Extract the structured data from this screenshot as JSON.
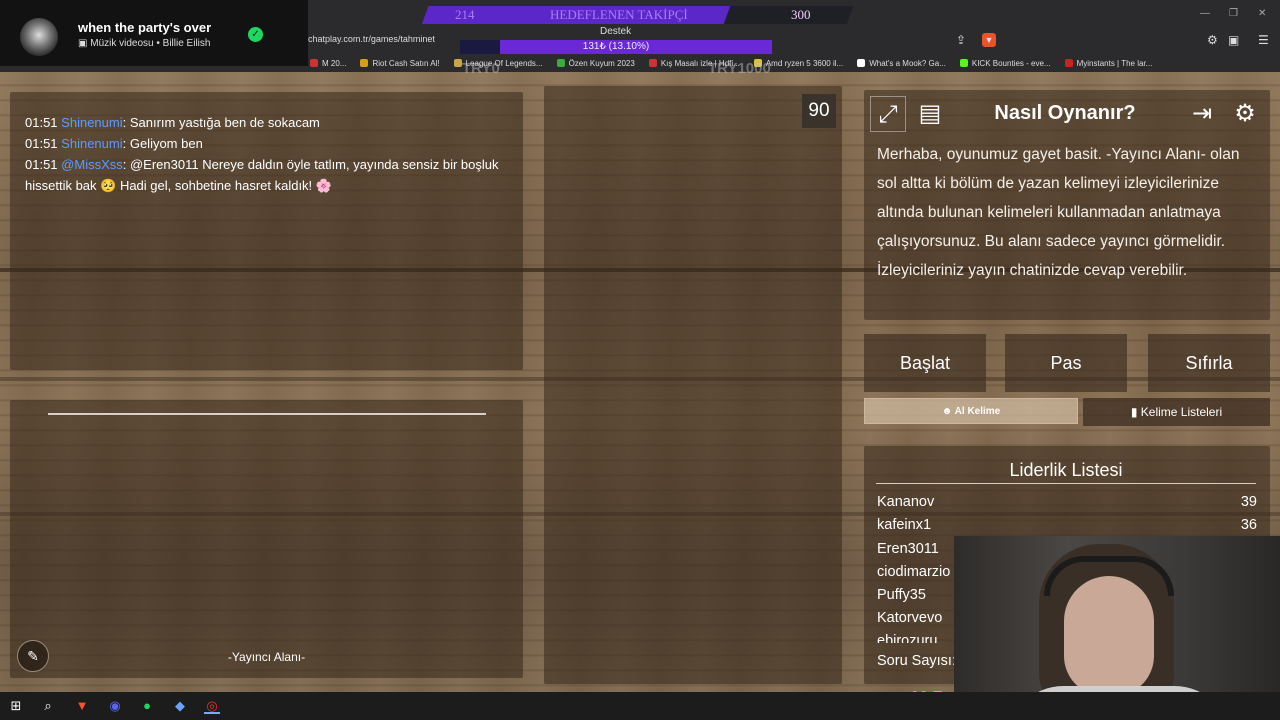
{
  "spotify": {
    "title": "when the party's over",
    "subtitle": "Müzik videosu • Billie Eilish"
  },
  "browser": {
    "url": "chatplay.com.tr/games/tahminet",
    "bookmarks": [
      "M 20...",
      "Riot Cash Satın Al!",
      "League Of Legends...",
      "Özen Kuyum 2023",
      "Kış Masalı izle | Hdfi...",
      "Amd ryzen 5 3600 il...",
      "What's a Mook? Ga...",
      "KICK Bounties - eve...",
      "Myinstants | The lar..."
    ]
  },
  "overlay": {
    "goal_current": "214",
    "goal_label": "HEDEFLENEN TAKİPÇİ",
    "goal_target": "300",
    "goal_fraction": 0.71,
    "support_label": "Destek",
    "support_text": "131₺ (13.10%)",
    "faded_left": "TRY0",
    "faded_right": "TRY1000"
  },
  "chat": {
    "messages": [
      {
        "time": "01:51",
        "user": "Shinenumi",
        "text": ": Sanırım yastığa ben de sokacam"
      },
      {
        "time": "01:51",
        "user": "Shinenumi",
        "text": ": Geliyom ben"
      },
      {
        "time": "01:51",
        "user": "@MissXss",
        "text": ": @Eren3011 Nereye daldın öyle tatlım, yayında sensiz bir boşluk hissettik bak 🥺 Hadi gel, sohbetine hasret kaldık! 🌸"
      }
    ]
  },
  "streamer_area": {
    "label": "-Yayıncı Alanı-"
  },
  "timer": "90",
  "how_to": {
    "title": "Nasıl Oynanır?",
    "body": "Merhaba, oyunumuz gayet basit. -Yayıncı Alanı- olan sol altta ki bölüm de yazan kelimeyi izleyicilerinize altında bulunan kelimeleri kullanmadan anlatmaya çalışıyorsunuz. Bu alanı sadece yayıncı görmelidir. İzleyicileriniz yayın chatinizde cevap verebilir."
  },
  "controls": {
    "start": "Başlat",
    "pass": "Pas",
    "reset": "Sıfırla",
    "get_word": "Al Kelime",
    "word_lists": "Kelime Listeleri"
  },
  "leaderboard": {
    "title": "Liderlik Listesi",
    "rows": [
      {
        "name": "Kananov",
        "score": "39"
      },
      {
        "name": "kafeinx1",
        "score": "36"
      },
      {
        "name": "Eren3011",
        "score": ""
      },
      {
        "name": "ciodimarzio",
        "score": ""
      },
      {
        "name": "Puffy35",
        "score": ""
      },
      {
        "name": "Katorvevo",
        "score": ""
      },
      {
        "name": "ebirozuru",
        "score": ""
      }
    ],
    "question_count_label": "Soru Sayısı:"
  },
  "kick_badge": "5",
  "colors": {
    "chat_user": "#5a9cff",
    "goal_fill": "#5b27c9",
    "kick": "#53fc18"
  }
}
